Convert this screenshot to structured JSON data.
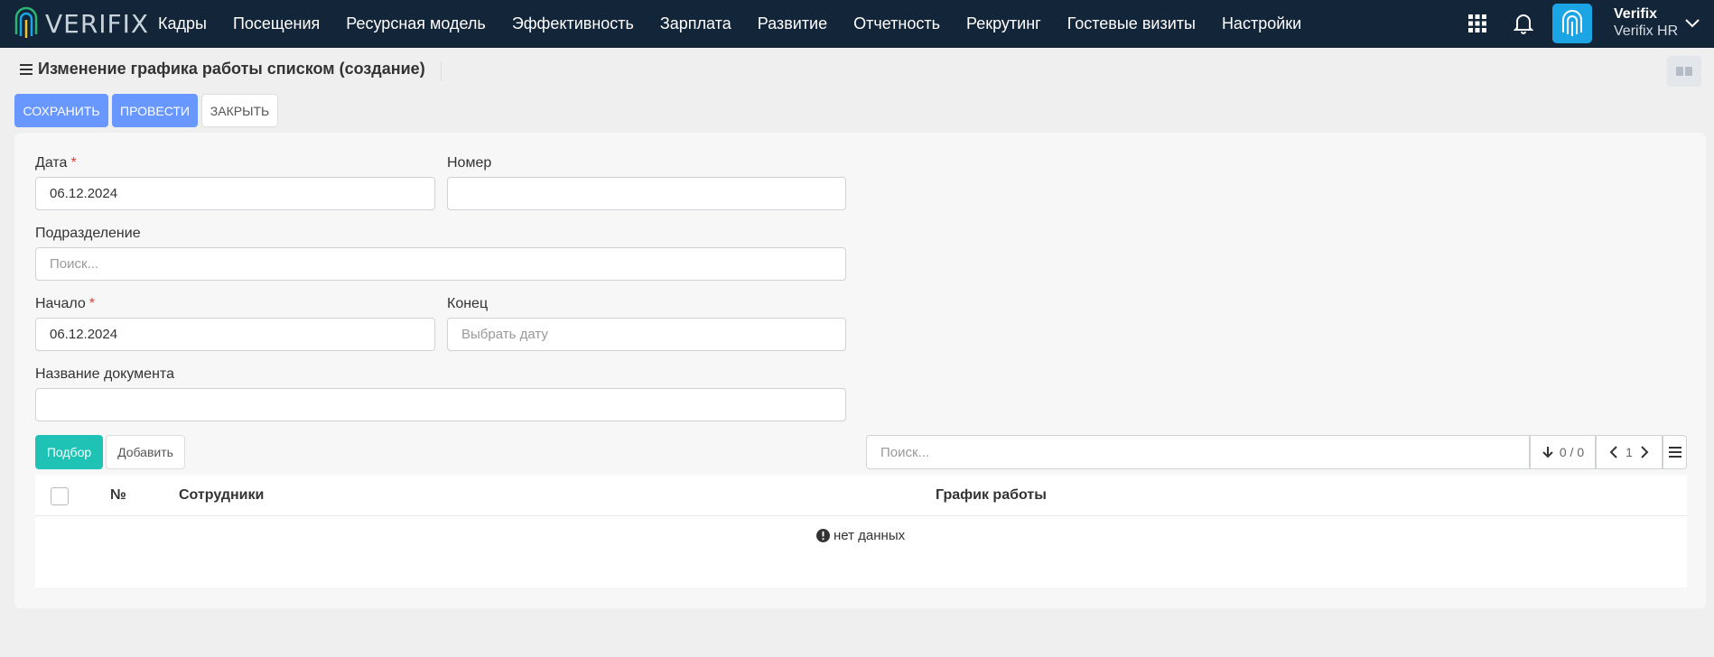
{
  "app": {
    "logo_text": "VERIFIX"
  },
  "nav": {
    "items": [
      "Кадры",
      "Посещения",
      "Ресурсная модель",
      "Эффективность",
      "Зарплата",
      "Развитие",
      "Отчетность",
      "Рекрутинг",
      "Гостевые визиты",
      "Настройки"
    ]
  },
  "user": {
    "name": "Verifix",
    "org": "Verifix HR"
  },
  "page": {
    "title": "Изменение графика работы списком (создание)"
  },
  "toolbar": {
    "save_label": "СОХРАНИТЬ",
    "post_label": "ПРОВЕСТИ",
    "close_label": "ЗАКРЫТЬ"
  },
  "form": {
    "date_label": "Дата",
    "date_value": "06.12.2024",
    "number_label": "Номер",
    "number_value": "",
    "division_label": "Подразделение",
    "division_placeholder": "Поиск...",
    "start_label": "Начало",
    "start_value": "06.12.2024",
    "end_label": "Конец",
    "end_placeholder": "Выбрать дату",
    "docname_label": "Название документа",
    "docname_value": "",
    "required_mark": "*"
  },
  "grid": {
    "select_label": "Подбор",
    "add_label": "Добавить",
    "search_placeholder": "Поиск...",
    "count_text": "0 / 0",
    "page_number": "1",
    "columns": [
      "№",
      "Сотрудники",
      "График работы"
    ],
    "empty_text": "нет данных"
  },
  "colors": {
    "topbar": "#132538",
    "primary": "#6797ff",
    "teal": "#1fc3b5",
    "avatar": "#1ba5e5"
  },
  "icons": [
    "apps-grid-icon",
    "bell-icon",
    "fingerprint-icon",
    "chevron-down-icon",
    "hamburger-menu-icon",
    "layout-toggle-icon",
    "sort-arrow-down-icon",
    "chevron-left-icon",
    "chevron-right-icon",
    "list-menu-icon",
    "exclamation-circle-icon"
  ]
}
